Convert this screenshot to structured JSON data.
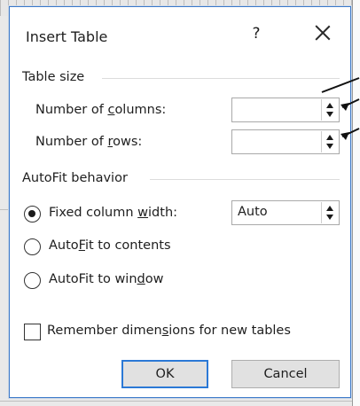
{
  "dialog": {
    "title": "Insert Table",
    "help_label": "?",
    "close_label": "Close"
  },
  "table_size": {
    "group_label": "Table size",
    "columns": {
      "label_pre": "Number of ",
      "label_u": "c",
      "label_post": "olumns:",
      "value": ""
    },
    "rows": {
      "label_pre": "Number of ",
      "label_u": "r",
      "label_post": "ows:",
      "value": ""
    }
  },
  "autofit": {
    "group_label": "AutoFit behavior",
    "options": [
      {
        "pre": "Fixed column ",
        "u": "w",
        "post": "idth:",
        "selected": true
      },
      {
        "pre": "Auto",
        "u": "F",
        "post": "it to contents",
        "selected": false
      },
      {
        "pre": "AutoFit to win",
        "u": "d",
        "post": "ow",
        "selected": false
      }
    ],
    "width_value": "Auto"
  },
  "remember": {
    "pre": "Remember dimen",
    "u": "s",
    "post": "ions for new tables",
    "checked": false
  },
  "buttons": {
    "ok_label": "OK",
    "cancel_label": "Cancel"
  },
  "colors": {
    "accent": "#2b79d6",
    "dialog_border": "#3a78c9"
  }
}
